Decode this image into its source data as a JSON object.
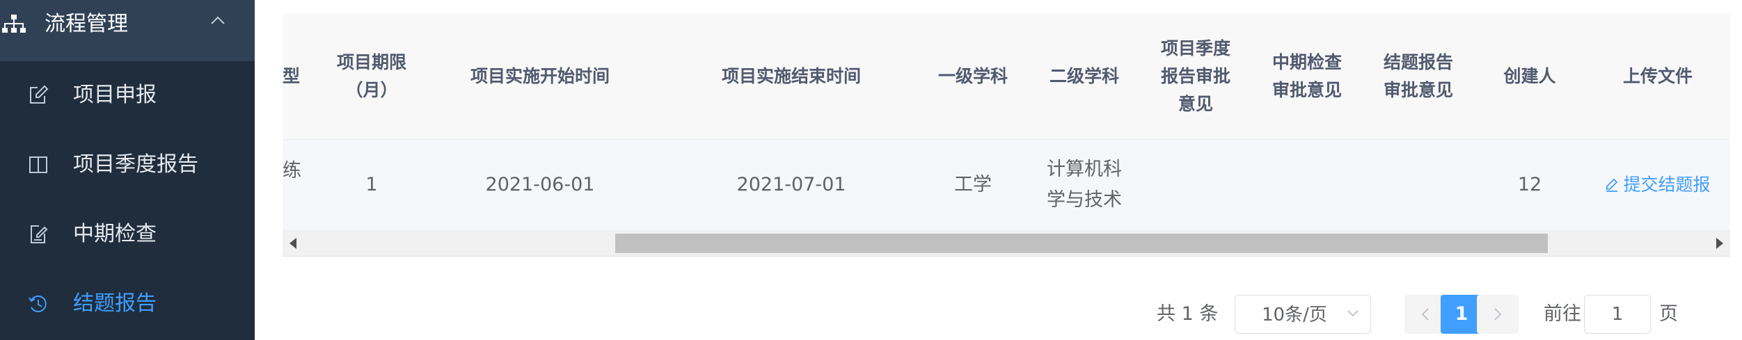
{
  "sidebar": {
    "header": {
      "label": "流程管理",
      "icon": "sitemap-icon"
    },
    "items": [
      {
        "label": "项目申报",
        "icon": "edit-icon",
        "active": false
      },
      {
        "label": "项目季度报告",
        "icon": "book-icon",
        "active": false
      },
      {
        "label": "中期检查",
        "icon": "checklist-icon",
        "active": false
      },
      {
        "label": "结题报告",
        "icon": "history-icon",
        "active": true
      }
    ]
  },
  "table": {
    "headers": [
      "型",
      "项目期限\n（月）",
      "项目实施开始时间",
      "项目实施结束时间",
      "一级学科",
      "二级学科",
      "项目季度\n报告审批\n意见",
      "中期检查\n审批意见",
      "结题报告\n审批意见",
      "创建人",
      "上传文件"
    ],
    "rows": [
      {
        "type": "练",
        "duration": "1",
        "start": "2021-06-01",
        "end": "2021-07-01",
        "discipline1": "工学",
        "discipline2": "计算机科\n学与技术",
        "quarterly_opinion": "",
        "midterm_opinion": "",
        "final_opinion": "",
        "creator": "12",
        "action": "提交结题报"
      }
    ]
  },
  "pagination": {
    "total_text": "共 1 条",
    "page_size": "10条/页",
    "current_page": "1",
    "goto_prefix": "前往",
    "goto_value": "1",
    "goto_suffix": "页"
  },
  "colors": {
    "sidebar_bg": "#304156",
    "submenu_bg": "#1f2d3d",
    "accent": "#409eff"
  }
}
